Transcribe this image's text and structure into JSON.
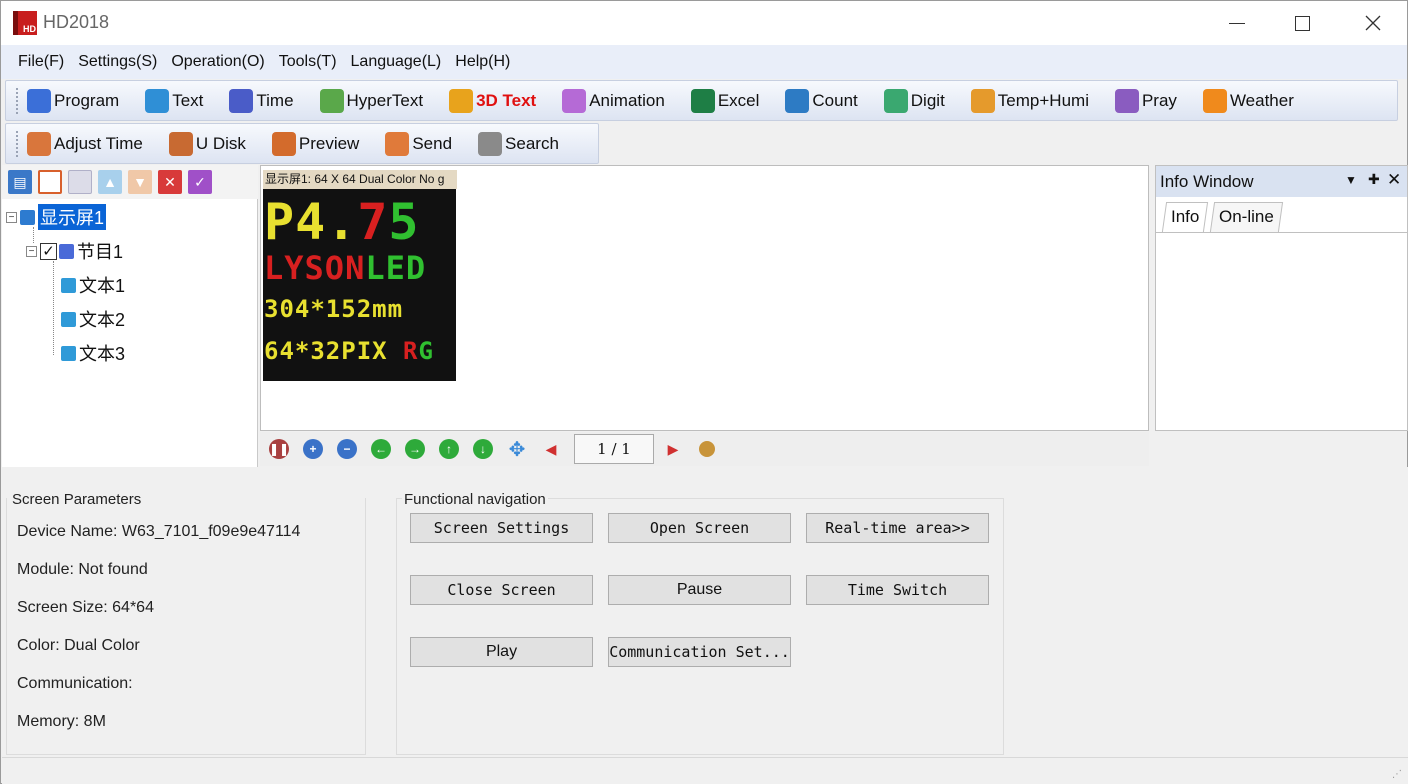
{
  "window": {
    "title": "HD2018",
    "logo_text": "HD",
    "controls": [
      "minimize-icon",
      "maximize-icon",
      "close-icon"
    ]
  },
  "menu": [
    "File(F)",
    "Settings(S)",
    "Operation(O)",
    "Tools(T)",
    "Language(L)",
    "Help(H)"
  ],
  "toolbar1": [
    {
      "label": "Program",
      "icon": "program-icon",
      "color": "#3b6fd8"
    },
    {
      "label": "Text",
      "icon": "book-icon",
      "color": "#2f8fd6"
    },
    {
      "label": "Time",
      "icon": "clock-icon",
      "color": "#4a5cc8"
    },
    {
      "label": "HyperText",
      "icon": "image-icon",
      "color": "#5aa84a"
    },
    {
      "label": "3D Text",
      "icon": "cube-icon",
      "color": "#e8a31c",
      "label_color": "#e01010"
    },
    {
      "label": "Animation",
      "icon": "flower-icon",
      "color": "#b56ad6"
    },
    {
      "label": "Excel",
      "icon": "excel-icon",
      "color": "#1e7e45"
    },
    {
      "label": "Count",
      "icon": "alarm-clock-icon",
      "color": "#2d7bc4"
    },
    {
      "label": "Digit",
      "icon": "calculator-icon",
      "color": "#3aa870"
    },
    {
      "label": "Temp+Humi",
      "icon": "thermometer-icon",
      "color": "#e59a2c"
    },
    {
      "label": "Pray",
      "icon": "pray-icon",
      "color": "#8a5cc0"
    },
    {
      "label": "Weather",
      "icon": "weather-icon",
      "color": "#f08a1c"
    }
  ],
  "toolbar2": [
    {
      "label": "Adjust Time",
      "icon": "adjust-time-icon",
      "color": "#d9763c"
    },
    {
      "label": "U Disk",
      "icon": "usb-disk-icon",
      "color": "#c86a32"
    },
    {
      "label": "Preview",
      "icon": "camera-icon",
      "color": "#d36b2c"
    },
    {
      "label": "Send",
      "icon": "send-arrow-icon",
      "color": "#e07a3a"
    },
    {
      "label": "Search",
      "icon": "magnifier-icon",
      "color": "#8a8a8a"
    }
  ],
  "tree": {
    "screen": "显示屏1",
    "program": "节目1",
    "items": [
      "文本1",
      "文本2",
      "文本3"
    ]
  },
  "preview": {
    "header": "显示屏1: 64 X 64  Dual Color No g",
    "led_lines": [
      {
        "parts": [
          {
            "text": "P4.",
            "color": "#e8e030"
          },
          {
            "text": "7",
            "color": "#d82020"
          },
          {
            "text": "5",
            "color": "#30c030"
          }
        ]
      },
      {
        "parts": [
          {
            "text": "LYSON",
            "color": "#d82020"
          },
          {
            "text": "LED",
            "color": "#30c030"
          }
        ]
      },
      {
        "parts": [
          {
            "text": "304*152mm",
            "color": "#e8e030"
          }
        ]
      },
      {
        "parts": [
          {
            "text": "64*32PIX ",
            "color": "#e8e030"
          },
          {
            "text": "R",
            "color": "#d82020"
          },
          {
            "text": "G",
            "color": "#30c030"
          }
        ]
      }
    ],
    "page_indicator": "1 / 1"
  },
  "info_window": {
    "title": "Info Window",
    "tabs": [
      "Info",
      "On-line"
    ]
  },
  "screen_parameters": {
    "title": "Screen Parameters",
    "device_name": "Device Name: W63_7101_f09e9e47114",
    "module": "Module: Not found",
    "screen_size": "Screen Size: 64*64",
    "color": "Color: Dual Color",
    "communication": "Communication:",
    "memory": "Memory: 8M"
  },
  "functional_navigation": {
    "title": "Functional navigation",
    "buttons": [
      "Screen Settings",
      "Open Screen",
      "Real-time area>>",
      "Close Screen",
      "Pause",
      "Time Switch",
      "Play",
      "Communication Set..."
    ]
  },
  "colors": {
    "selected": "#0a64d6",
    "menu_bg": "#e9eef9",
    "info_title_bg": "#d9e2f1"
  }
}
